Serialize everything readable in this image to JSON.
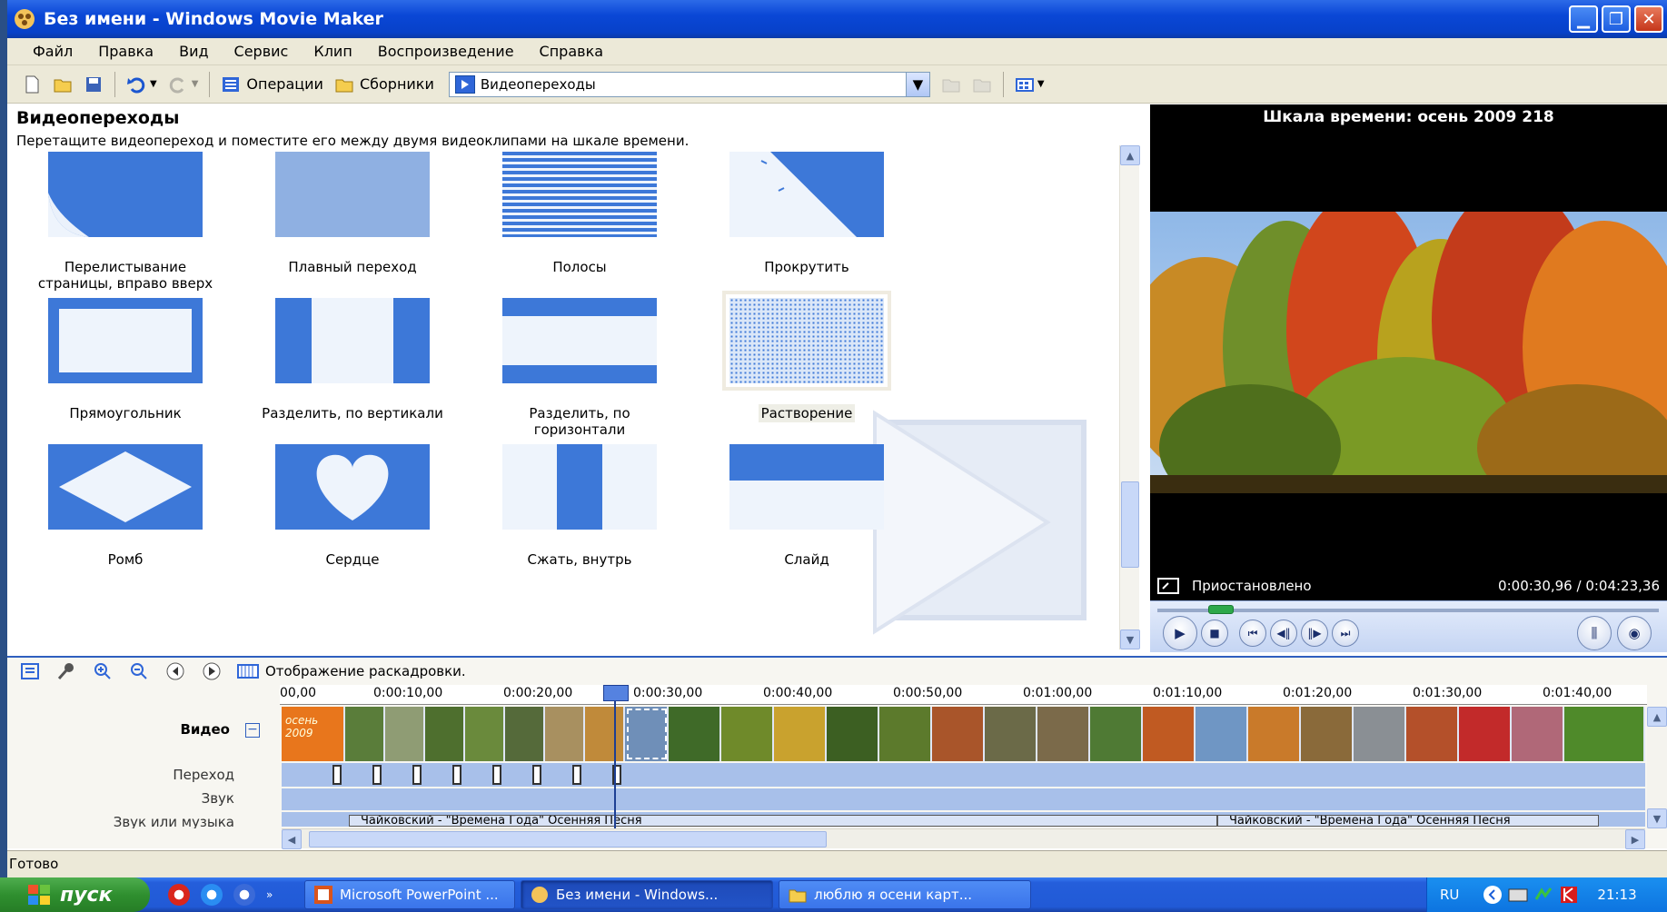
{
  "window": {
    "title": "Без имени - Windows Movie Maker"
  },
  "menu": [
    "Файл",
    "Правка",
    "Вид",
    "Сервис",
    "Клип",
    "Воспроизведение",
    "Справка"
  ],
  "toolbar": {
    "operations_label": "Операции",
    "collections_label": "Сборники",
    "combo_value": "Видеопереходы"
  },
  "transitions_pane": {
    "title": "Видеопереходы",
    "instruction": "Перетащите видеопереход и поместите его между двумя видеоклипами на шкале времени.",
    "items": [
      {
        "line1": "Перелистывание",
        "line2": "страницы, вправо вверх",
        "icon": "page-curl"
      },
      {
        "line1": "Плавный переход",
        "line2": "",
        "icon": "fade"
      },
      {
        "line1": "Полосы",
        "line2": "",
        "icon": "bars"
      },
      {
        "line1": "Прокрутить",
        "line2": "",
        "icon": "roll"
      },
      {
        "line1": "Прямоугольник",
        "line2": "",
        "icon": "rectangle"
      },
      {
        "line1": "Разделить, по вертикали",
        "line2": "",
        "icon": "split-vertical"
      },
      {
        "line1": "Разделить, по",
        "line2": "горизонтали",
        "icon": "split-horizontal"
      },
      {
        "line1": "Растворение",
        "line2": "",
        "icon": "dissolve",
        "selected": true
      },
      {
        "line1": "Ромб",
        "line2": "",
        "icon": "diamond"
      },
      {
        "line1": "Сердце",
        "line2": "",
        "icon": "heart"
      },
      {
        "line1": "Сжать, внутрь",
        "line2": "",
        "icon": "squeeze-in"
      },
      {
        "line1": "Слайд",
        "line2": "",
        "icon": "slide"
      }
    ]
  },
  "preview": {
    "title": "Шкала времени: осень 2009 218",
    "status": "Приостановлено",
    "time": "0:00:30,96 / 0:04:23,36",
    "seek_fraction": 0.117
  },
  "timeline": {
    "toolbar_label": "Отображение раскадровки.",
    "ruler": [
      "00,00",
      "0:00:10,00",
      "0:00:20,00",
      "0:00:30,00",
      "0:00:40,00",
      "0:00:50,00",
      "0:01:00,00",
      "0:01:10,00",
      "0:01:20,00",
      "0:01:30,00",
      "0:01:40,00"
    ],
    "tracks": {
      "video": "Видео",
      "transition": "Переход",
      "audio": "Звук",
      "music": "Звук или музыка"
    },
    "music_clip_1": "Чайковский - \"Времена Года\" Осенняя Песня",
    "music_clip_2": "Чайковский - \"Времена Года\" Осенняя Песня",
    "first_clip_text": "осень 2009"
  },
  "status_bar": "Готово",
  "taskbar": {
    "start": "пуск",
    "tasks": [
      "Microsoft PowerPoint ...",
      "Без имени - Windows...",
      "люблю я осени карт..."
    ],
    "lang": "RU",
    "clock": "21:13"
  },
  "colors": {
    "xp_blue": "#0a47d6",
    "tile_blue": "#3d78d8",
    "timeline_track": "#a8c0ea"
  }
}
